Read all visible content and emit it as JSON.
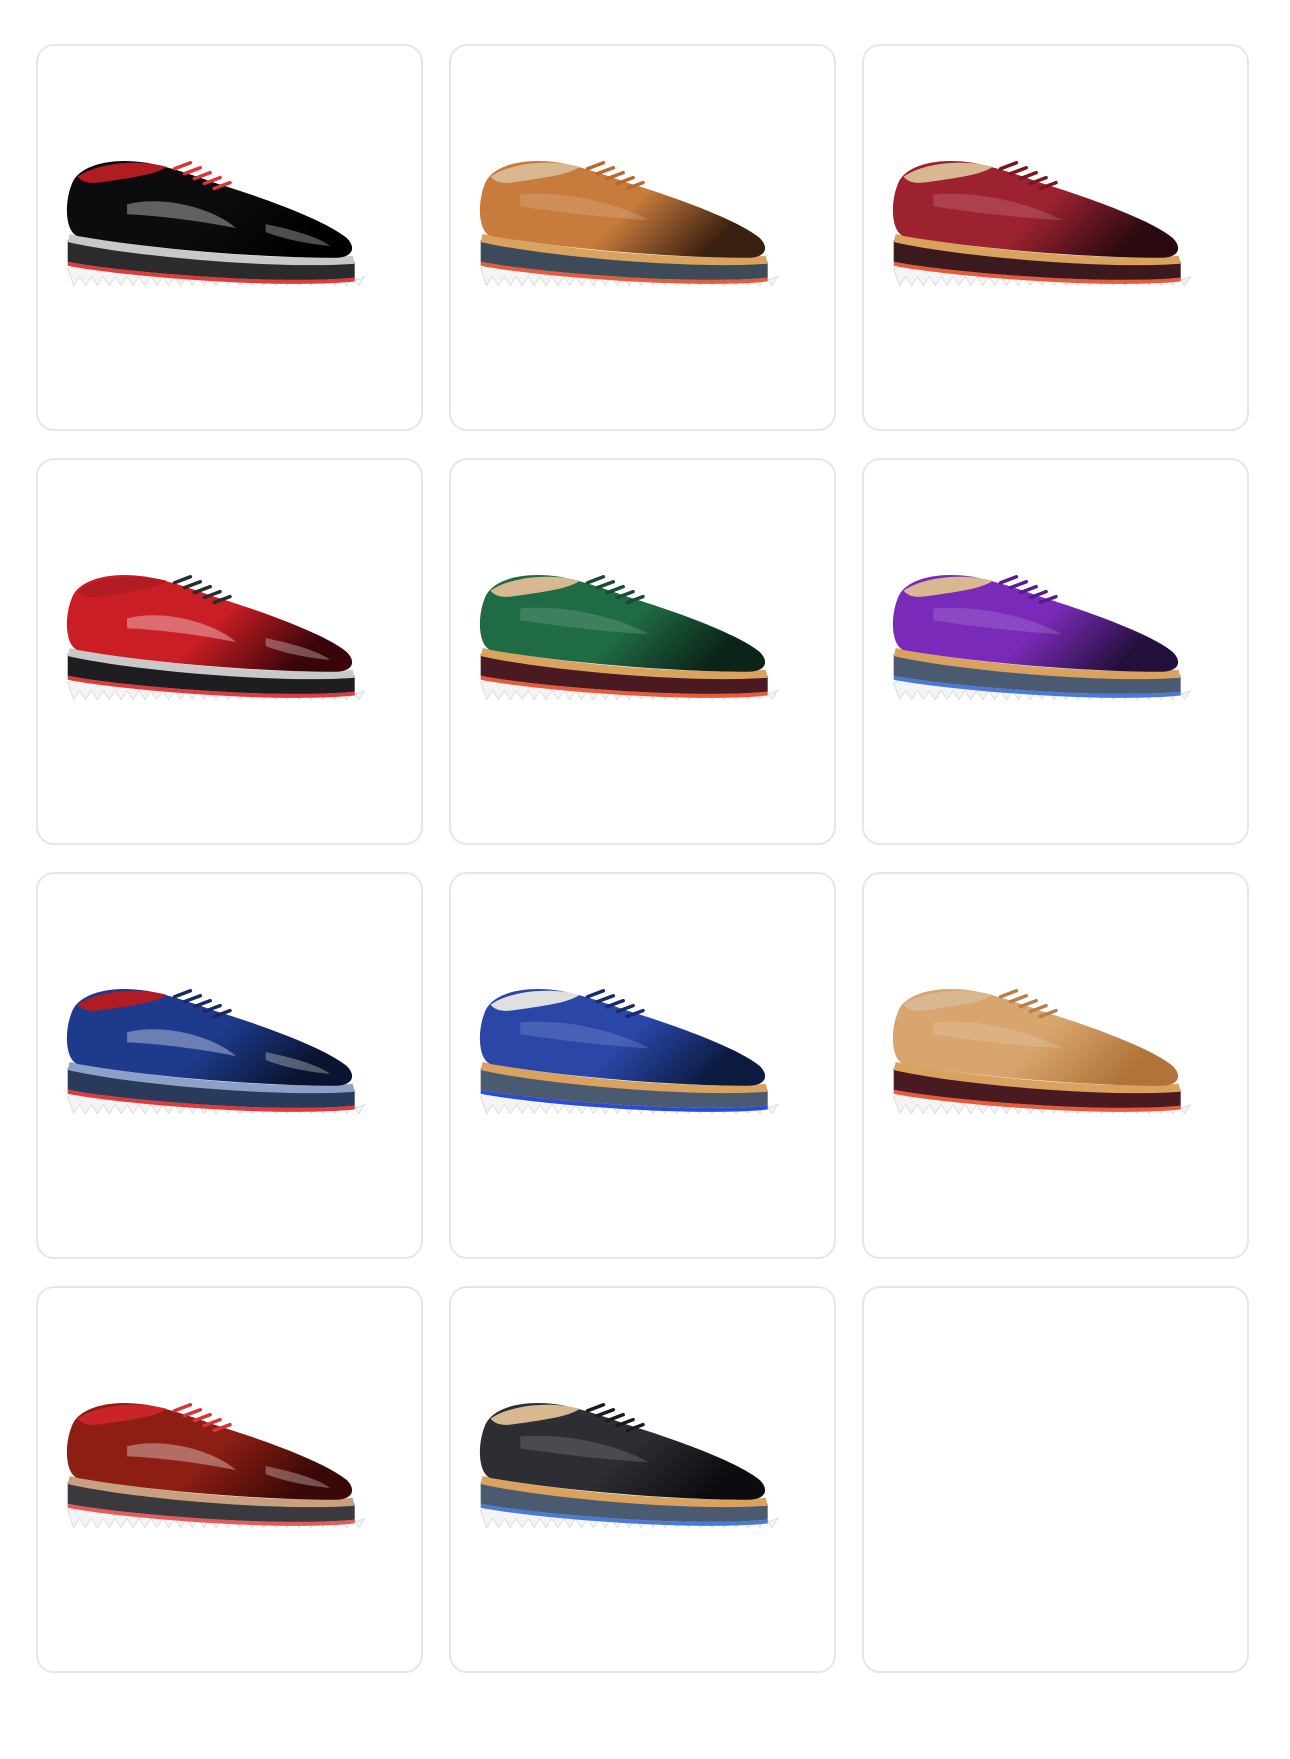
{
  "gallery": {
    "items": [
      {
        "upper": "#0c0c0e",
        "toe": "#000000",
        "lining": "#b01c22",
        "laces": "#d9343a",
        "midsole": "#2b2b2e",
        "welt": "#c8c8c8",
        "stripe": "#e23a3a",
        "patent": true
      },
      {
        "upper": "#c77b3c",
        "toe": "#3a2010",
        "lining": "#d8b890",
        "laces": "#b86830",
        "midsole": "#3c4a5a",
        "welt": "#d9a25e",
        "stripe": "#e85a3a",
        "patent": false
      },
      {
        "upper": "#9c2230",
        "toe": "#2a0a10",
        "lining": "#d8b890",
        "laces": "#7a1522",
        "midsole": "#3a1a1e",
        "welt": "#d9a25e",
        "stripe": "#e85a3a",
        "patent": false
      },
      {
        "upper": "#c81e24",
        "toe": "#3a0508",
        "lining": "#b01c22",
        "laces": "#2a2a30",
        "midsole": "#1e1e22",
        "welt": "#c8c8c8",
        "stripe": "#e23a3a",
        "patent": true
      },
      {
        "upper": "#1f6b45",
        "toe": "#0c2418",
        "lining": "#d8b890",
        "laces": "#1a4a32",
        "midsole": "#4a1a22",
        "welt": "#d9a25e",
        "stripe": "#e85a3a",
        "patent": false
      },
      {
        "upper": "#7a2ab8",
        "toe": "#22103a",
        "lining": "#d8b890",
        "laces": "#5a1a8a",
        "midsole": "#4a5a70",
        "welt": "#d9a25e",
        "stripe": "#4a7ad8",
        "patent": false
      },
      {
        "upper": "#1e3a8c",
        "toe": "#0a1430",
        "lining": "#b01c22",
        "laces": "#1a2a60",
        "midsole": "#2a3a5a",
        "welt": "#8ca0c8",
        "stripe": "#e23a3a",
        "patent": true
      },
      {
        "upper": "#2a47a8",
        "toe": "#0c1a40",
        "lining": "#e0e0e0",
        "laces": "#1a2a6a",
        "midsole": "#4a5a70",
        "welt": "#d9a25e",
        "stripe": "#2a4ad8",
        "patent": false
      },
      {
        "upper": "#d8a56e",
        "toe": "#b07438",
        "lining": "#d8b890",
        "laces": "#b88048",
        "midsole": "#4a1a22",
        "welt": "#d9a25e",
        "stripe": "#e85a3a",
        "patent": false
      },
      {
        "upper": "#8c1e14",
        "toe": "#3a0806",
        "lining": "#c8242a",
        "laces": "#d9343a",
        "midsole": "#3a3a3e",
        "welt": "#c8a080",
        "stripe": "#e85a5a",
        "patent": true
      },
      {
        "upper": "#2c2e34",
        "toe": "#0c0c10",
        "lining": "#d8b890",
        "laces": "#1a1a1e",
        "midsole": "#4a5a70",
        "welt": "#d9a25e",
        "stripe": "#4a7ad8",
        "patent": false
      },
      null
    ]
  }
}
